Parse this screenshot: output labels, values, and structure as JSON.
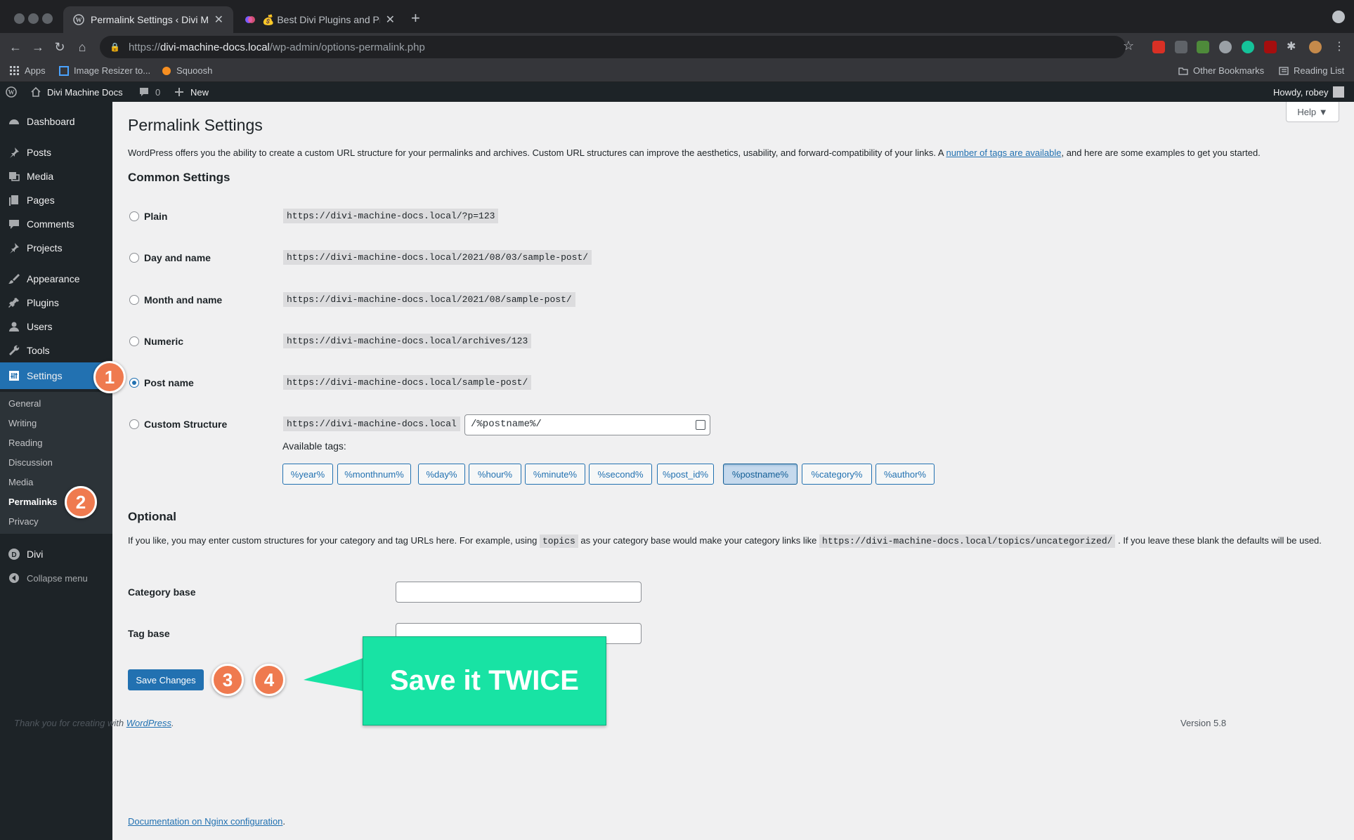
{
  "browser": {
    "tabs": [
      {
        "title": "Permalink Settings ‹ Divi Machine Docs",
        "active": true
      },
      {
        "title": "💰 Best Divi Plugins and Premium",
        "active": false
      }
    ],
    "url_scheme": "https://",
    "url_host": "divi-machine-docs.local",
    "url_path": "/wp-admin/options-permalink.php",
    "bookmarks": [
      "Apps",
      "Image Resizer to...",
      "Squoosh"
    ],
    "bookmarks_right": [
      "Other Bookmarks",
      "Reading List"
    ]
  },
  "adminbar": {
    "site_name": "Divi Machine Docs",
    "comments_count": "0",
    "new_label": "New",
    "howdy": "Howdy, robey"
  },
  "sidebar": {
    "items": [
      {
        "label": "Dashboard",
        "icon": "dashboard-icon"
      },
      {
        "label": "Posts",
        "icon": "pin-icon"
      },
      {
        "label": "Media",
        "icon": "media-icon"
      },
      {
        "label": "Pages",
        "icon": "pages-icon"
      },
      {
        "label": "Comments",
        "icon": "comment-icon"
      },
      {
        "label": "Projects",
        "icon": "pin-icon"
      },
      {
        "label": "Appearance",
        "icon": "brush-icon"
      },
      {
        "label": "Plugins",
        "icon": "plug-icon"
      },
      {
        "label": "Users",
        "icon": "user-icon"
      },
      {
        "label": "Tools",
        "icon": "wrench-icon"
      },
      {
        "label": "Settings",
        "icon": "settings-icon",
        "current": true
      },
      {
        "label": "Divi",
        "icon": "divi-icon"
      }
    ],
    "submenu": [
      "General",
      "Writing",
      "Reading",
      "Discussion",
      "Media",
      "Permalinks",
      "Privacy"
    ],
    "submenu_current": "Permalinks",
    "collapse_label": "Collapse menu"
  },
  "main": {
    "help_label": "Help ▼",
    "title": "Permalink Settings",
    "intro_before": "WordPress offers you the ability to create a custom URL structure for your permalinks and archives. Custom URL structures can improve the aesthetics, usability, and forward-compatibility of your links. A ",
    "intro_link": "number of tags are available",
    "intro_after": ", and here are some examples to get you started.",
    "common_heading": "Common Settings",
    "options": [
      {
        "label": "Plain",
        "example": "https://divi-machine-docs.local/?p=123",
        "checked": false
      },
      {
        "label": "Day and name",
        "example": "https://divi-machine-docs.local/2021/08/03/sample-post/",
        "checked": false
      },
      {
        "label": "Month and name",
        "example": "https://divi-machine-docs.local/2021/08/sample-post/",
        "checked": false
      },
      {
        "label": "Numeric",
        "example": "https://divi-machine-docs.local/archives/123",
        "checked": false
      },
      {
        "label": "Post name",
        "example": "https://divi-machine-docs.local/sample-post/",
        "checked": true
      },
      {
        "label": "Custom Structure",
        "example": "https://divi-machine-docs.local",
        "checked": false
      }
    ],
    "custom_value": "/%postname%/",
    "available_tags_label": "Available tags:",
    "tags": [
      "%year%",
      "%monthnum%",
      "%day%",
      "%hour%",
      "%minute%",
      "%second%",
      "%post_id%",
      "%postname%",
      "%category%",
      "%author%"
    ],
    "active_tag": "%postname%",
    "optional_heading": "Optional",
    "optional_p1": "If you like, you may enter custom structures for your category and tag URLs here. For example, using ",
    "optional_code1": "topics",
    "optional_p2": " as your category base would make your category links like ",
    "optional_code2": "https://divi-machine-docs.local/topics/uncategorized/",
    "optional_p3": " . If you leave these blank the defaults will be used.",
    "category_base_label": "Category base",
    "category_base_value": "",
    "tag_base_label": "Tag base",
    "tag_base_value": "",
    "save_label": "Save Changes",
    "nginx_link": "Documentation on Nginx configuration",
    "nginx_after": "."
  },
  "annotations": {
    "badges": [
      "1",
      "2",
      "3",
      "4"
    ],
    "callout": "Save it TWICE",
    "badge_color": "#ef7a4f",
    "callout_color": "#18e3a4"
  },
  "footer": {
    "thanks_before": "Thank you for creating with ",
    "thanks_link": "WordPress",
    "thanks_after": ".",
    "version": "Version 5.8"
  },
  "colors": {
    "wp_blue": "#2271b1",
    "admin_dark": "#1d2327"
  }
}
